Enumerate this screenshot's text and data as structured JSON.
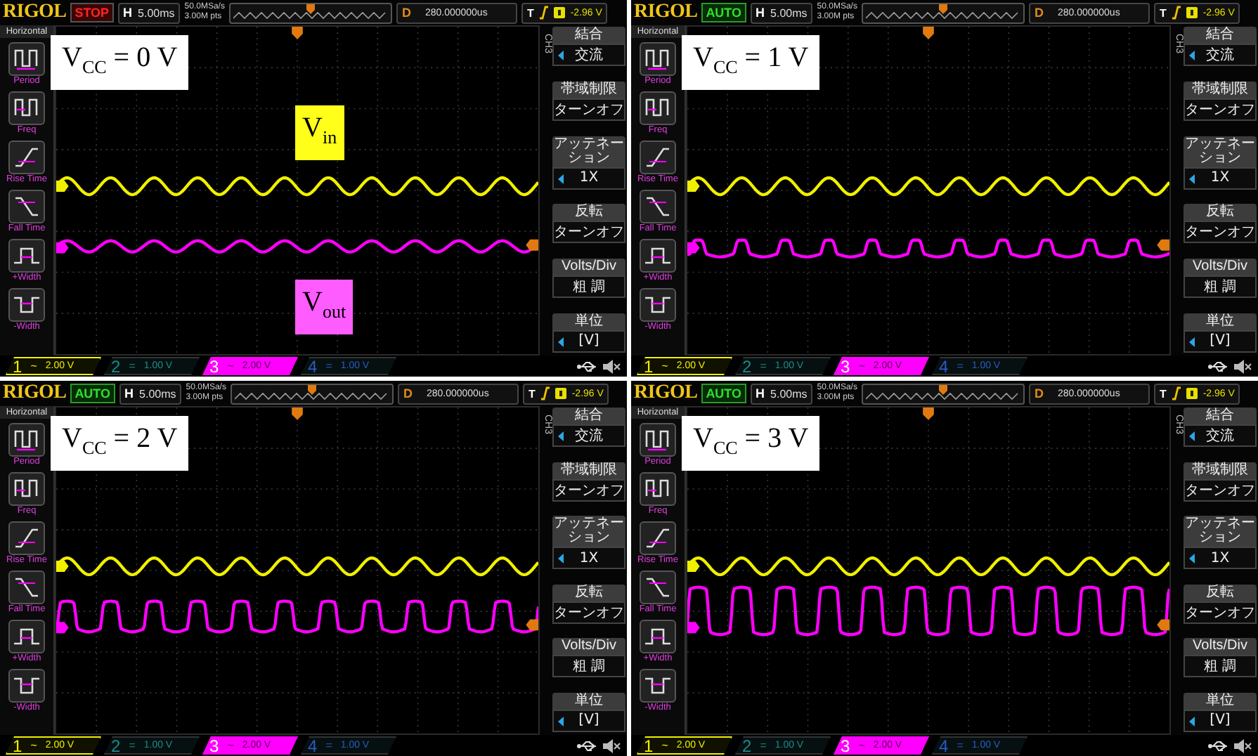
{
  "panels": [
    {
      "logo": "RIGOL",
      "status": {
        "text": "STOP",
        "kind": "stop"
      },
      "timebase_label": "H",
      "timebase": "5.00ms",
      "sample_rate": "50.0MSa/s",
      "memory_depth": "3.00M pts",
      "delay_label": "D",
      "delay": "280.000000us",
      "trigger_label": "T",
      "trigger_level": "-2.96 V",
      "measure_menu": {
        "title": "Horizontal",
        "items": [
          {
            "label": "Period",
            "kind": "period"
          },
          {
            "label": "Freq",
            "kind": "freq"
          },
          {
            "label": "Rise Time",
            "kind": "rise"
          },
          {
            "label": "Fall Time",
            "kind": "fall"
          },
          {
            "label": "+Width",
            "kind": "pwidth"
          },
          {
            "label": "-Width",
            "kind": "nwidth"
          }
        ]
      },
      "channel_menu": {
        "channel": "CH3",
        "items": [
          {
            "title": "結合",
            "value": "交流",
            "arrow": true
          },
          {
            "title": "帯域制限",
            "value": "ターンオフ",
            "arrow": false
          },
          {
            "title": "アッテネーション",
            "value": "1X",
            "arrow": true
          },
          {
            "title": "反転",
            "value": "ターンオフ",
            "arrow": false
          },
          {
            "title": "Volts/Div",
            "value": "粗 調",
            "arrow": false
          },
          {
            "title": "単位",
            "value": "[V]",
            "arrow": true
          }
        ]
      },
      "channels": [
        {
          "number": "1",
          "coupling": "~",
          "scale": "2.00 V",
          "color": "#f0f000",
          "on": true,
          "selected": false
        },
        {
          "number": "2",
          "coupling": "=",
          "scale": "1.00 V",
          "color": "#1c8c8c",
          "on": false,
          "selected": false
        },
        {
          "number": "3",
          "coupling": "~",
          "scale": "2.00 V",
          "color": "#ff00ff",
          "on": true,
          "selected": true
        },
        {
          "number": "4",
          "coupling": "=",
          "scale": "1.00 V",
          "color": "#2a5cc8",
          "on": false,
          "selected": false
        }
      ],
      "label": "V$_{CC}$ = 0 V",
      "annotations": [
        {
          "text": "V$_{in}$",
          "kind": "vin"
        },
        {
          "text": "V$_{out}$",
          "kind": "vout"
        }
      ],
      "output_trace": {
        "kind": "sine"
      }
    },
    {
      "logo": "RIGOL",
      "status": {
        "text": "AUTO",
        "kind": "auto"
      },
      "timebase_label": "H",
      "timebase": "5.00ms",
      "sample_rate": "50.0MSa/s",
      "memory_depth": "3.00M pts",
      "delay_label": "D",
      "delay": "280.000000us",
      "trigger_label": "T",
      "trigger_level": "-2.96 V",
      "measure_menu": {
        "title": "Horizontal",
        "items": [
          {
            "label": "Period",
            "kind": "period"
          },
          {
            "label": "Freq",
            "kind": "freq"
          },
          {
            "label": "Rise Time",
            "kind": "rise"
          },
          {
            "label": "Fall Time",
            "kind": "fall"
          },
          {
            "label": "+Width",
            "kind": "pwidth"
          },
          {
            "label": "-Width",
            "kind": "nwidth"
          }
        ]
      },
      "channel_menu": {
        "channel": "CH3",
        "items": [
          {
            "title": "結合",
            "value": "交流",
            "arrow": true
          },
          {
            "title": "帯域制限",
            "value": "ターンオフ",
            "arrow": false
          },
          {
            "title": "アッテネーション",
            "value": "1X",
            "arrow": true
          },
          {
            "title": "反転",
            "value": "ターンオフ",
            "arrow": false
          },
          {
            "title": "Volts/Div",
            "value": "粗 調",
            "arrow": false
          },
          {
            "title": "単位",
            "value": "[V]",
            "arrow": true
          }
        ]
      },
      "channels": [
        {
          "number": "1",
          "coupling": "~",
          "scale": "2.00 V",
          "color": "#f0f000",
          "on": true,
          "selected": false
        },
        {
          "number": "2",
          "coupling": "=",
          "scale": "1.00 V",
          "color": "#1c8c8c",
          "on": false,
          "selected": false
        },
        {
          "number": "3",
          "coupling": "~",
          "scale": "2.00 V",
          "color": "#ff00ff",
          "on": true,
          "selected": true
        },
        {
          "number": "4",
          "coupling": "=",
          "scale": "1.00 V",
          "color": "#2a5cc8",
          "on": false,
          "selected": false
        }
      ],
      "label": "V$_{CC}$ = 1 V",
      "output_trace": {
        "kind": "clipped_low"
      }
    },
    {
      "logo": "RIGOL",
      "status": {
        "text": "AUTO",
        "kind": "auto"
      },
      "timebase_label": "H",
      "timebase": "5.00ms",
      "sample_rate": "50.0MSa/s",
      "memory_depth": "3.00M pts",
      "delay_label": "D",
      "delay": "280.000000us",
      "trigger_label": "T",
      "trigger_level": "-2.96 V",
      "measure_menu": {
        "title": "Horizontal",
        "items": [
          {
            "label": "Period",
            "kind": "period"
          },
          {
            "label": "Freq",
            "kind": "freq"
          },
          {
            "label": "Rise Time",
            "kind": "rise"
          },
          {
            "label": "Fall Time",
            "kind": "fall"
          },
          {
            "label": "+Width",
            "kind": "pwidth"
          },
          {
            "label": "-Width",
            "kind": "nwidth"
          }
        ]
      },
      "channel_menu": {
        "channel": "CH3",
        "items": [
          {
            "title": "結合",
            "value": "交流",
            "arrow": true
          },
          {
            "title": "帯域制限",
            "value": "ターンオフ",
            "arrow": false
          },
          {
            "title": "アッテネーション",
            "value": "1X",
            "arrow": true
          },
          {
            "title": "反転",
            "value": "ターンオフ",
            "arrow": false
          },
          {
            "title": "Volts/Div",
            "value": "粗 調",
            "arrow": false
          },
          {
            "title": "単位",
            "value": "[V]",
            "arrow": true
          }
        ]
      },
      "channels": [
        {
          "number": "1",
          "coupling": "~",
          "scale": "2.00 V",
          "color": "#f0f000",
          "on": true,
          "selected": false
        },
        {
          "number": "2",
          "coupling": "=",
          "scale": "1.00 V",
          "color": "#1c8c8c",
          "on": false,
          "selected": false
        },
        {
          "number": "3",
          "coupling": "~",
          "scale": "2.00 V",
          "color": "#ff00ff",
          "on": true,
          "selected": true
        },
        {
          "number": "4",
          "coupling": "=",
          "scale": "1.00 V",
          "color": "#2a5cc8",
          "on": false,
          "selected": false
        }
      ],
      "label": "V$_{CC}$ = 2 V",
      "output_trace": {
        "kind": "clipped_mid"
      }
    },
    {
      "logo": "RIGOL",
      "status": {
        "text": "AUTO",
        "kind": "auto"
      },
      "timebase_label": "H",
      "timebase": "5.00ms",
      "sample_rate": "50.0MSa/s",
      "memory_depth": "3.00M pts",
      "delay_label": "D",
      "delay": "280.000000us",
      "trigger_label": "T",
      "trigger_level": "-2.96 V",
      "measure_menu": {
        "title": "Horizontal",
        "items": [
          {
            "label": "Period",
            "kind": "period"
          },
          {
            "label": "Freq",
            "kind": "freq"
          },
          {
            "label": "Rise Time",
            "kind": "rise"
          },
          {
            "label": "Fall Time",
            "kind": "fall"
          },
          {
            "label": "+Width",
            "kind": "pwidth"
          },
          {
            "label": "-Width",
            "kind": "nwidth"
          }
        ]
      },
      "channel_menu": {
        "channel": "CH3",
        "items": [
          {
            "title": "結合",
            "value": "交流",
            "arrow": true
          },
          {
            "title": "帯域制限",
            "value": "ターンオフ",
            "arrow": false
          },
          {
            "title": "アッテネーション",
            "value": "1X",
            "arrow": true
          },
          {
            "title": "反転",
            "value": "ターンオフ",
            "arrow": false
          },
          {
            "title": "Volts/Div",
            "value": "粗 調",
            "arrow": false
          },
          {
            "title": "単位",
            "value": "[V]",
            "arrow": true
          }
        ]
      },
      "channels": [
        {
          "number": "1",
          "coupling": "~",
          "scale": "2.00 V",
          "color": "#f0f000",
          "on": true,
          "selected": false
        },
        {
          "number": "2",
          "coupling": "=",
          "scale": "1.00 V",
          "color": "#1c8c8c",
          "on": false,
          "selected": false
        },
        {
          "number": "3",
          "coupling": "~",
          "scale": "2.00 V",
          "color": "#ff00ff",
          "on": true,
          "selected": true
        },
        {
          "number": "4",
          "coupling": "=",
          "scale": "1.00 V",
          "color": "#2a5cc8",
          "on": false,
          "selected": false
        }
      ],
      "label": "V$_{CC}$ = 3 V",
      "output_trace": {
        "kind": "clipped_high"
      }
    }
  ]
}
